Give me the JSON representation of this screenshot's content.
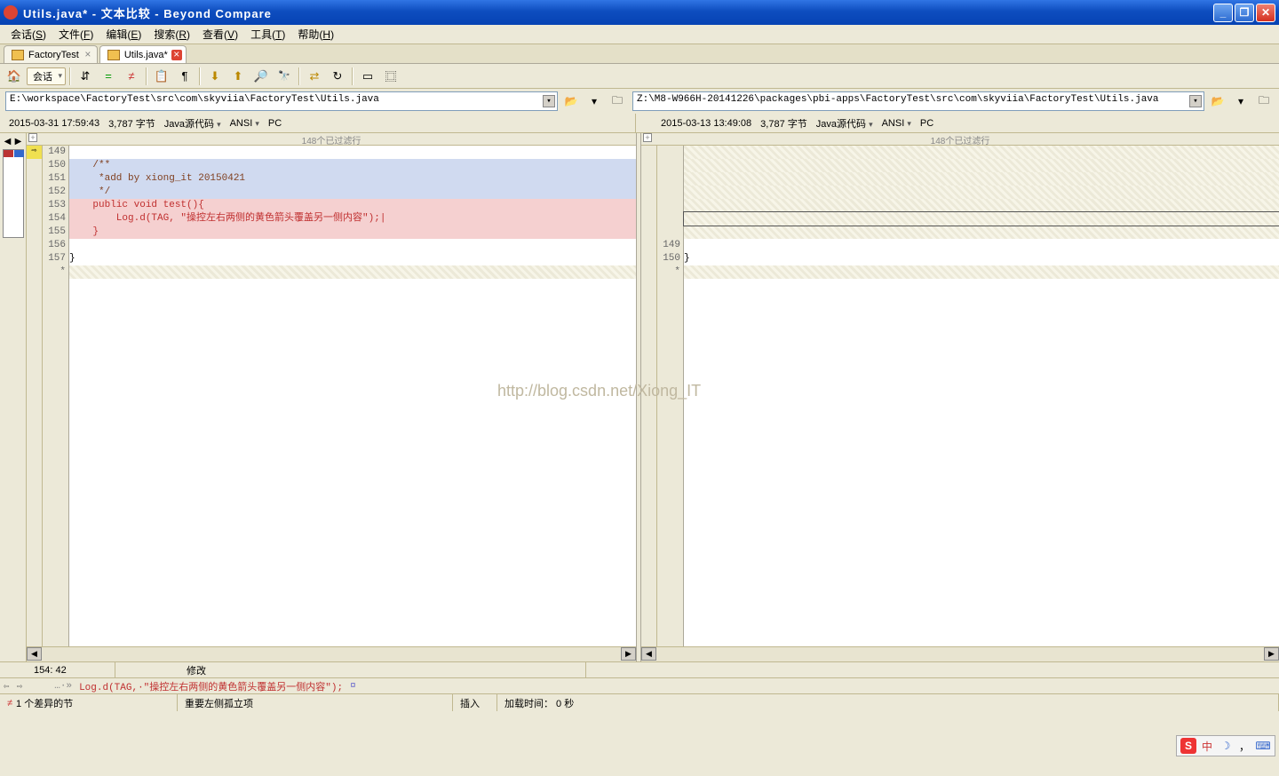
{
  "title": "Utils.java* - 文本比较 - Beyond Compare",
  "menus": [
    {
      "label": "会话",
      "key": "S"
    },
    {
      "label": "文件",
      "key": "F"
    },
    {
      "label": "编辑",
      "key": "E"
    },
    {
      "label": "搜索",
      "key": "R"
    },
    {
      "label": "查看",
      "key": "V"
    },
    {
      "label": "工具",
      "key": "T"
    },
    {
      "label": "帮助",
      "key": "H"
    }
  ],
  "tabs": [
    {
      "label": "FactoryTest",
      "active": false,
      "close_red": false
    },
    {
      "label": "Utils.java*",
      "active": true,
      "close_red": true
    }
  ],
  "toolbar": {
    "session_label": "会话"
  },
  "paths": {
    "left": "E:\\workspace\\FactoryTest\\src\\com\\skyviia\\FactoryTest\\Utils.java",
    "right": "Z:\\M8-W966H-20141226\\packages\\pbi-apps\\FactoryTest\\src\\com\\skyviia\\FactoryTest\\Utils.java"
  },
  "info": {
    "left": {
      "ts": "2015-03-31 17:59:43",
      "size": "3,787 字节",
      "type": "Java源代码",
      "enc": "ANSI",
      "le": "PC"
    },
    "right": {
      "ts": "2015-03-13 13:49:08",
      "size": "3,787 字节",
      "type": "Java源代码",
      "enc": "ANSI",
      "le": "PC"
    }
  },
  "codehdr": "148个已过滤行",
  "left_lines": [
    {
      "n": "149",
      "bg": "normal",
      "txt": ""
    },
    {
      "n": "150",
      "bg": "blue",
      "cls": "txt-brown",
      "txt": "    /**"
    },
    {
      "n": "151",
      "bg": "blue",
      "cls": "txt-brown",
      "txt": "     *add by xiong_it 20150421"
    },
    {
      "n": "152",
      "bg": "blue",
      "cls": "txt-brown",
      "txt": "     */"
    },
    {
      "n": "153",
      "bg": "red",
      "cls": "txt-red",
      "txt": "    public void test(){"
    },
    {
      "n": "154",
      "bg": "red",
      "cls": "txt-red",
      "txt": "        Log.d(TAG, \"操控左右两侧的黄色箭头覆盖另一侧内容\");|"
    },
    {
      "n": "155",
      "bg": "red",
      "cls": "txt-red",
      "txt": "    }"
    },
    {
      "n": "156",
      "bg": "normal",
      "cls": "txt-black",
      "txt": ""
    },
    {
      "n": "157",
      "bg": "normal",
      "cls": "txt-black",
      "txt": "}"
    },
    {
      "n": "*",
      "bg": "hatch",
      "txt": ""
    }
  ],
  "right_lines": [
    {
      "n": "",
      "bg": "hatch",
      "txt": ""
    },
    {
      "n": "",
      "bg": "hatch",
      "txt": ""
    },
    {
      "n": "",
      "bg": "hatch",
      "txt": ""
    },
    {
      "n": "",
      "bg": "hatch",
      "txt": ""
    },
    {
      "n": "",
      "bg": "hatch",
      "txt": ""
    },
    {
      "n": "",
      "bg": "hatch-out",
      "txt": ""
    },
    {
      "n": "",
      "bg": "hatch",
      "txt": ""
    },
    {
      "n": "149",
      "bg": "normal",
      "txt": ""
    },
    {
      "n": "150",
      "bg": "normal",
      "cls": "txt-black",
      "txt": "}"
    },
    {
      "n": "*",
      "bg": "hatch",
      "txt": ""
    }
  ],
  "posbar": {
    "pos": "154: 42",
    "mod": "修改"
  },
  "diffline": {
    "prefix": "…·»",
    "text": "Log.d(TAG,·\"操控左右两侧的黄色箭头覆盖另一侧内容\");",
    "suffix": "¤"
  },
  "status": {
    "diff": "1 个差异的节",
    "important": "重要左侧孤立项",
    "mode": "插入",
    "load": "加载时间： 0 秒"
  },
  "watermark": "http://blog.csdn.net/Xiong_IT",
  "ime": {
    "s": "S",
    "cn": "中",
    "moon": "☽",
    "comma": "，",
    "key": "⌨"
  }
}
